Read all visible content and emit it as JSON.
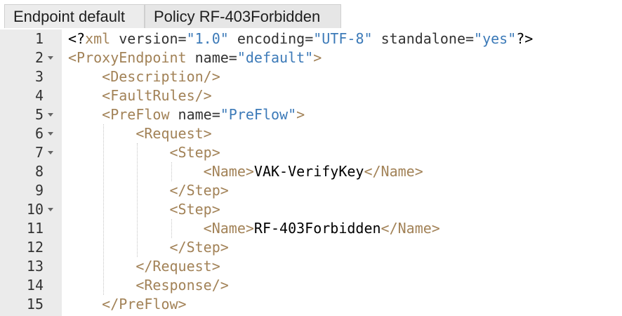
{
  "tabs": [
    {
      "label": "Endpoint default",
      "active": true
    },
    {
      "label": "Policy RF-403Forbidden",
      "active": false
    }
  ],
  "colors": {
    "tag": "#a28257",
    "attribute_value": "#3c7ab8",
    "text": "#000000",
    "gutter_bg": "#ebebeb",
    "tab_bg": "#e6e6e6"
  },
  "editor": {
    "lines": [
      {
        "number": "1",
        "foldable": false,
        "indent": 0,
        "tokens": [
          {
            "t": "pi",
            "v": "<?"
          },
          {
            "t": "tag",
            "v": "xml"
          },
          {
            "t": "attr",
            "v": " version"
          },
          {
            "t": "eq",
            "v": "="
          },
          {
            "t": "str",
            "v": "\"1.0\""
          },
          {
            "t": "attr",
            "v": " encoding"
          },
          {
            "t": "eq",
            "v": "="
          },
          {
            "t": "str",
            "v": "\"UTF-8\""
          },
          {
            "t": "attr",
            "v": " standalone"
          },
          {
            "t": "eq",
            "v": "="
          },
          {
            "t": "str",
            "v": "\"yes\""
          },
          {
            "t": "pi",
            "v": "?>"
          }
        ]
      },
      {
        "number": "2",
        "foldable": true,
        "indent": 0,
        "tokens": [
          {
            "t": "tag",
            "v": "<ProxyEndpoint"
          },
          {
            "t": "attr",
            "v": " name"
          },
          {
            "t": "eq",
            "v": "="
          },
          {
            "t": "str",
            "v": "\"default\""
          },
          {
            "t": "tag",
            "v": ">"
          }
        ]
      },
      {
        "number": "3",
        "foldable": false,
        "indent": 1,
        "tokens": [
          {
            "t": "tag",
            "v": "<Description/>"
          }
        ]
      },
      {
        "number": "4",
        "foldable": false,
        "indent": 1,
        "tokens": [
          {
            "t": "tag",
            "v": "<FaultRules/>"
          }
        ]
      },
      {
        "number": "5",
        "foldable": true,
        "indent": 1,
        "tokens": [
          {
            "t": "tag",
            "v": "<PreFlow"
          },
          {
            "t": "attr",
            "v": " name"
          },
          {
            "t": "eq",
            "v": "="
          },
          {
            "t": "str",
            "v": "\"PreFlow\""
          },
          {
            "t": "tag",
            "v": ">"
          }
        ]
      },
      {
        "number": "6",
        "foldable": true,
        "indent": 2,
        "tokens": [
          {
            "t": "tag",
            "v": "<Request>"
          }
        ]
      },
      {
        "number": "7",
        "foldable": true,
        "indent": 3,
        "tokens": [
          {
            "t": "tag",
            "v": "<Step>"
          }
        ]
      },
      {
        "number": "8",
        "foldable": false,
        "indent": 4,
        "tokens": [
          {
            "t": "tag",
            "v": "<Name>"
          },
          {
            "t": "text",
            "v": "VAK-VerifyKey"
          },
          {
            "t": "tag",
            "v": "</Name>"
          }
        ]
      },
      {
        "number": "9",
        "foldable": false,
        "indent": 3,
        "tokens": [
          {
            "t": "tag",
            "v": "</Step>"
          }
        ]
      },
      {
        "number": "10",
        "foldable": true,
        "indent": 3,
        "tokens": [
          {
            "t": "tag",
            "v": "<Step>"
          }
        ]
      },
      {
        "number": "11",
        "foldable": false,
        "indent": 4,
        "tokens": [
          {
            "t": "tag",
            "v": "<Name>"
          },
          {
            "t": "text",
            "v": "RF-403Forbidden"
          },
          {
            "t": "tag",
            "v": "</Name>"
          }
        ]
      },
      {
        "number": "12",
        "foldable": false,
        "indent": 3,
        "tokens": [
          {
            "t": "tag",
            "v": "</Step>"
          }
        ]
      },
      {
        "number": "13",
        "foldable": false,
        "indent": 2,
        "tokens": [
          {
            "t": "tag",
            "v": "</Request>"
          }
        ]
      },
      {
        "number": "14",
        "foldable": false,
        "indent": 2,
        "tokens": [
          {
            "t": "tag",
            "v": "<Response/>"
          }
        ]
      },
      {
        "number": "15",
        "foldable": false,
        "indent": 1,
        "tokens": [
          {
            "t": "tag",
            "v": "</PreFlow>"
          }
        ]
      }
    ]
  }
}
